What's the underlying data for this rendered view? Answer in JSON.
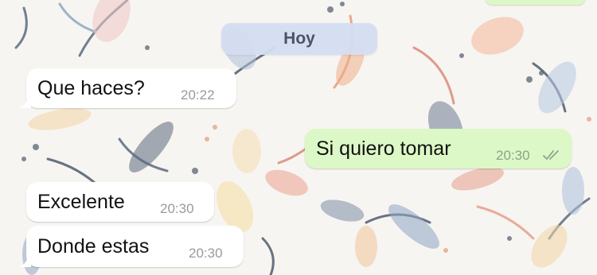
{
  "chat": {
    "date_label": "Hoy",
    "messages": [
      {
        "direction": "incoming",
        "text": "Que haces?",
        "time": "20:22"
      },
      {
        "direction": "outgoing",
        "text": "Si quiero tomar",
        "time": "20:30",
        "status": "read"
      },
      {
        "direction": "incoming",
        "text": "Excelente",
        "time": "20:30"
      },
      {
        "direction": "incoming",
        "text": "Donde estas",
        "time": "20:30"
      }
    ]
  },
  "colors": {
    "incoming_bubble": "#ffffff",
    "outgoing_bubble": "#dcf8c6",
    "date_pill": "#d4ddf0",
    "wallpaper": "#f7f5f1"
  }
}
